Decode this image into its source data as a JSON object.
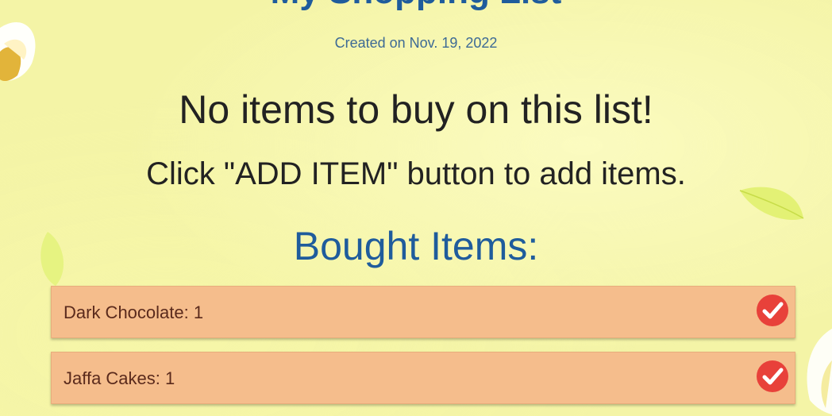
{
  "header": {
    "title": "My Shopping List",
    "created": "Created on Nov. 19, 2022"
  },
  "main": {
    "empty_message": "No items to buy on this list!",
    "hint": "Click \"ADD ITEM\" button to add items.",
    "bought_heading": "Bought Items:"
  },
  "bought_items": [
    {
      "label": "Dark Chocolate: 1",
      "icon": "check-circle-icon"
    },
    {
      "label": "Jaffa Cakes: 1",
      "icon": "check-circle-icon"
    }
  ],
  "colors": {
    "background": "#f4f4a6",
    "heading_blue": "#1f5c9c",
    "item_background": "#f5bd8c",
    "check_red": "#e8413a"
  }
}
